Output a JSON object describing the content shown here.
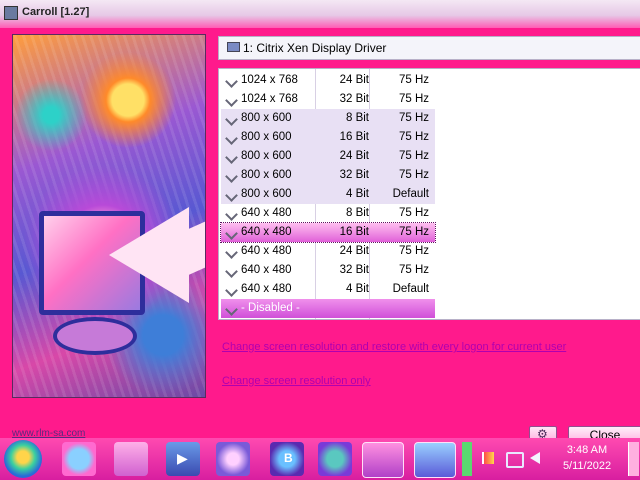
{
  "window": {
    "title": "Carroll [1.27]",
    "title_icon": "app-icon"
  },
  "adapter": {
    "label": "1: Citrix Xen Display Driver",
    "icon": "monitor-icon"
  },
  "modes": [
    {
      "resolution": "1024 x 768",
      "depth": "24 Bit",
      "rate": "75 Hz"
    },
    {
      "resolution": "1024 x 768",
      "depth": "32 Bit",
      "rate": "75 Hz"
    },
    {
      "resolution": "800 x 600",
      "depth": "8 Bit",
      "rate": "75 Hz"
    },
    {
      "resolution": "800 x 600",
      "depth": "16 Bit",
      "rate": "75 Hz"
    },
    {
      "resolution": "800 x 600",
      "depth": "24 Bit",
      "rate": "75 Hz"
    },
    {
      "resolution": "800 x 600",
      "depth": "32 Bit",
      "rate": "75 Hz"
    },
    {
      "resolution": "800 x 600",
      "depth": "4 Bit",
      "rate": "Default"
    },
    {
      "resolution": "640 x 480",
      "depth": "8 Bit",
      "rate": "75 Hz"
    },
    {
      "resolution": "640 x 480",
      "depth": "16 Bit",
      "rate": "75 Hz",
      "selected": true
    },
    {
      "resolution": "640 x 480",
      "depth": "24 Bit",
      "rate": "75 Hz"
    },
    {
      "resolution": "640 x 480",
      "depth": "32 Bit",
      "rate": "75 Hz"
    },
    {
      "resolution": "640 x 480",
      "depth": "4 Bit",
      "rate": "Default"
    }
  ],
  "disabled_label": "- Disabled -",
  "links": {
    "change_and_restore": "Change screen resolution and restore with every logon for current user",
    "change_only": "Change screen resolution only"
  },
  "footer": {
    "website": "www.rlm-sa.com",
    "close_label": "Close",
    "settings_icon": "gear-icon"
  },
  "taskbar": {
    "clock_time": "3:48 AM",
    "clock_date": "5/11/2022",
    "items": [
      "start-orb",
      "internet-explorer",
      "windows-explorer",
      "media-player",
      "browser",
      "b-app",
      "settings-app",
      "carroll-app",
      "display-app"
    ]
  }
}
